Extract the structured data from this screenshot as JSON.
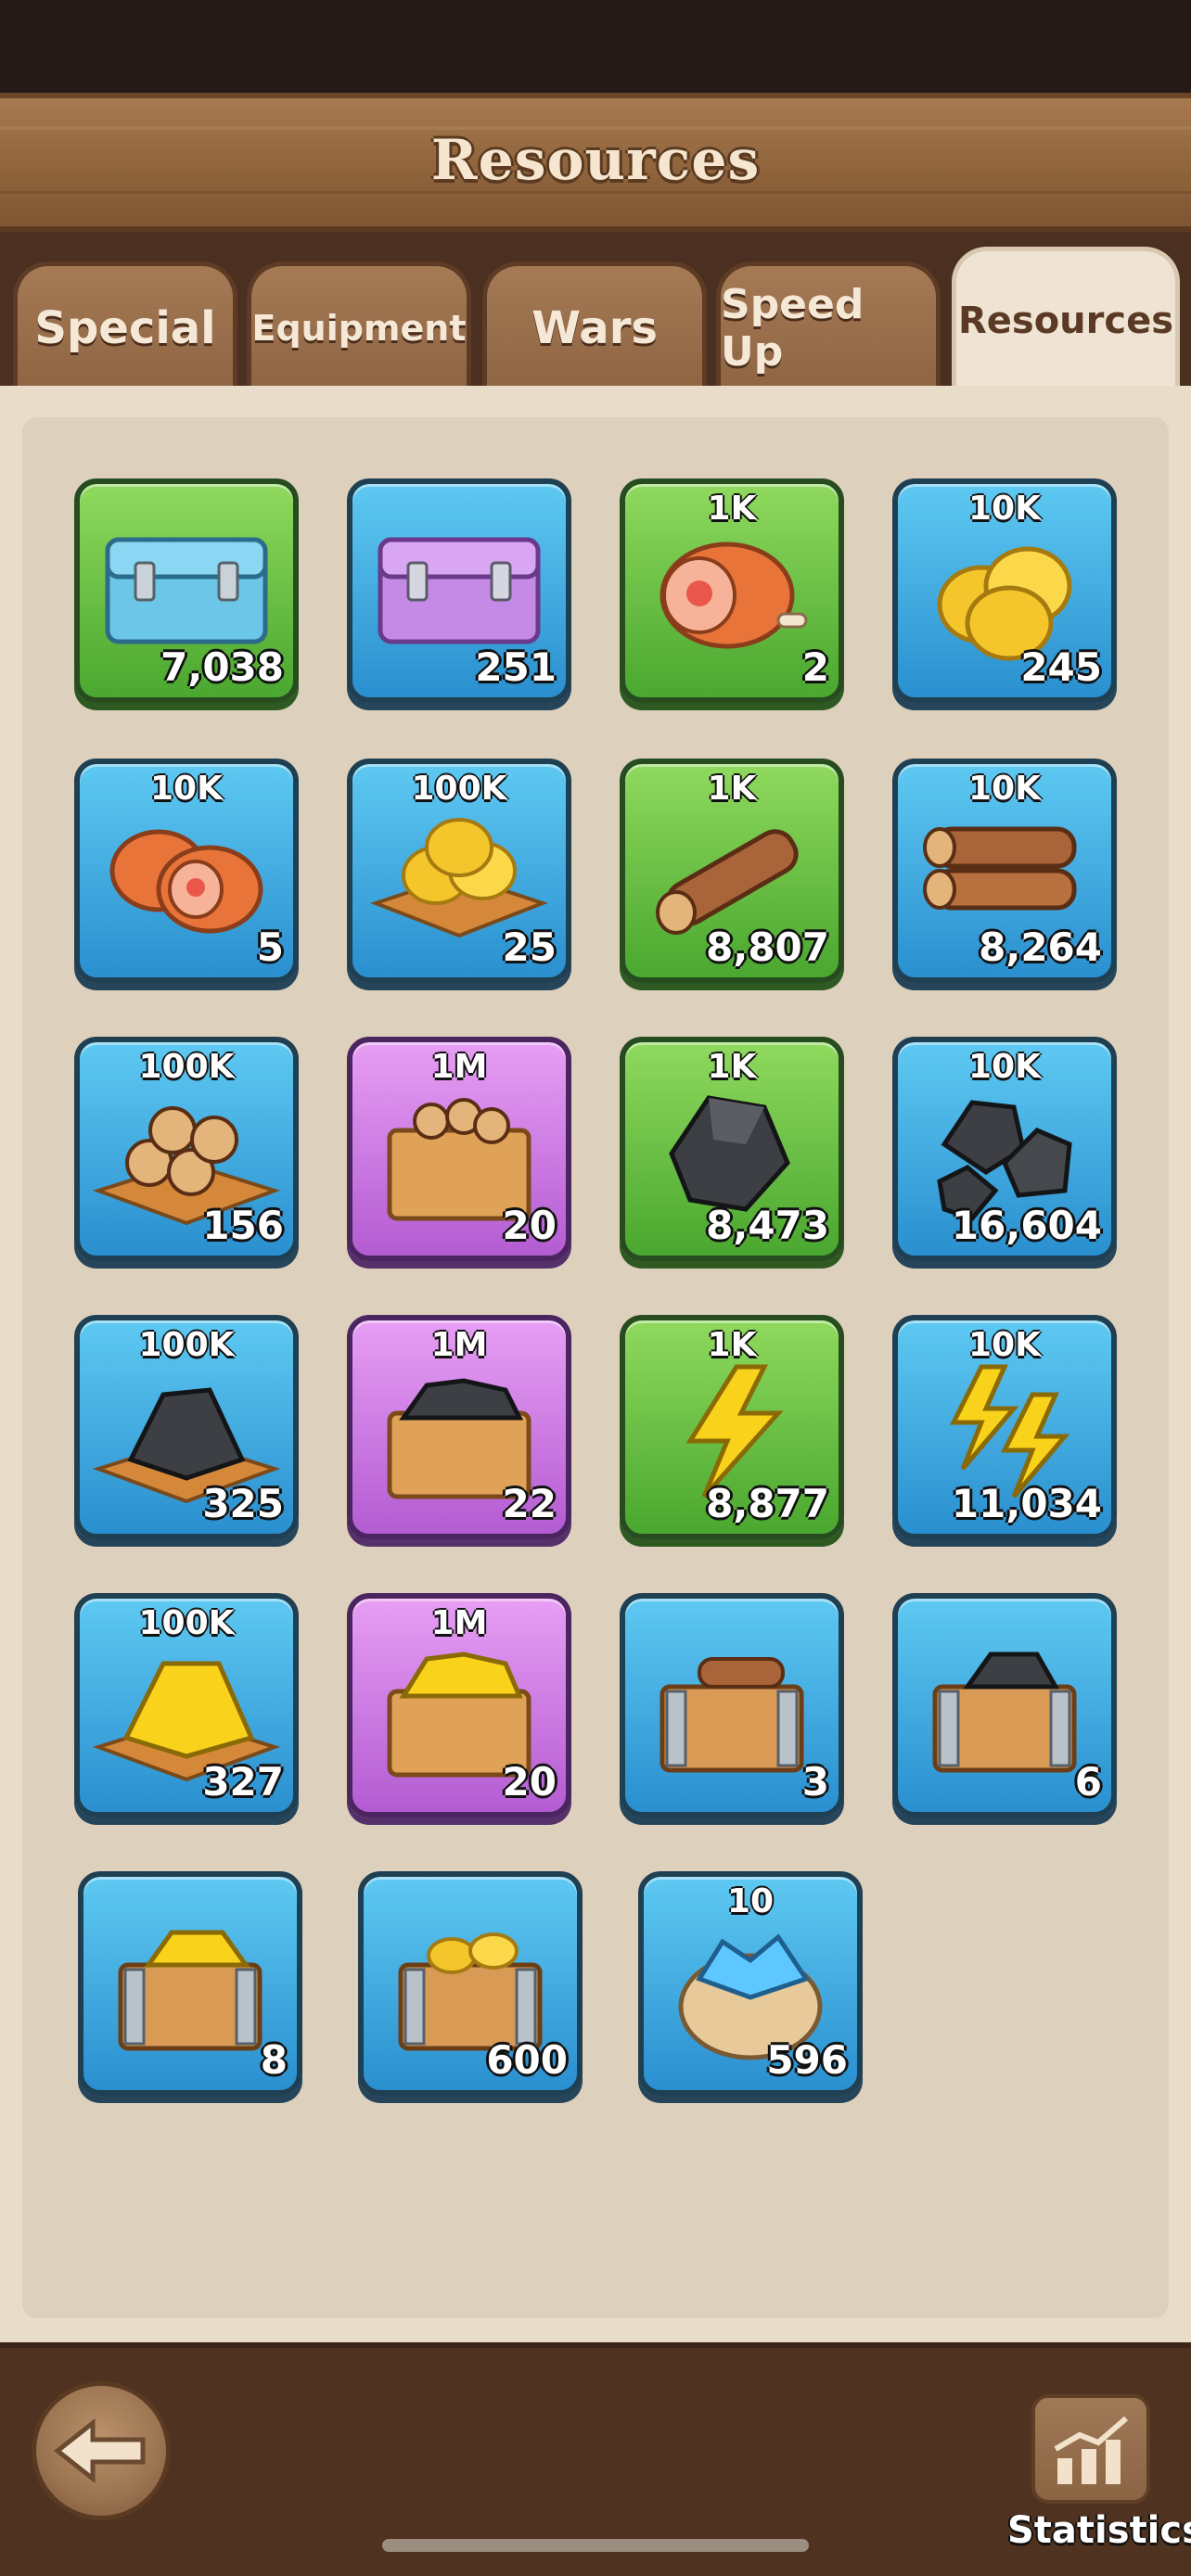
{
  "header": {
    "title": "Resources"
  },
  "tabs": [
    {
      "label": "Special"
    },
    {
      "label": "Equipment"
    },
    {
      "label": "Wars"
    },
    {
      "label": "Speed Up"
    },
    {
      "label": "Resources",
      "active": true
    }
  ],
  "items": [
    {
      "icon": "blue-chest-icon",
      "amount": "",
      "count": "7,038",
      "tile": "green"
    },
    {
      "icon": "purple-chest-icon",
      "amount": "",
      "count": "251",
      "tile": "blue"
    },
    {
      "icon": "meat-icon",
      "amount": "1K",
      "count": "2",
      "tile": "green"
    },
    {
      "icon": "gold-coins-icon",
      "amount": "10K",
      "count": "245",
      "tile": "blue"
    },
    {
      "icon": "meat-pile-icon",
      "amount": "10K",
      "count": "5",
      "tile": "blue"
    },
    {
      "icon": "gold-coins-pallet-icon",
      "amount": "100K",
      "count": "25",
      "tile": "blue"
    },
    {
      "icon": "wood-log-icon",
      "amount": "1K",
      "count": "8,807",
      "tile": "green"
    },
    {
      "icon": "wood-logs-icon",
      "amount": "10K",
      "count": "8,264",
      "tile": "blue"
    },
    {
      "icon": "wood-pallet-icon",
      "amount": "100K",
      "count": "156",
      "tile": "blue"
    },
    {
      "icon": "wood-crate-icon",
      "amount": "1M",
      "count": "20",
      "tile": "purple"
    },
    {
      "icon": "stone-icon",
      "amount": "1K",
      "count": "8,473",
      "tile": "green"
    },
    {
      "icon": "stones-icon",
      "amount": "10K",
      "count": "16,604",
      "tile": "blue"
    },
    {
      "icon": "stone-pallet-icon",
      "amount": "100K",
      "count": "325",
      "tile": "blue"
    },
    {
      "icon": "stone-crate-icon",
      "amount": "1M",
      "count": "22",
      "tile": "purple"
    },
    {
      "icon": "energy-bolt-icon",
      "amount": "1K",
      "count": "8,877",
      "tile": "green"
    },
    {
      "icon": "energy-bolts-icon",
      "amount": "10K",
      "count": "11,034",
      "tile": "blue"
    },
    {
      "icon": "energy-pallet-icon",
      "amount": "100K",
      "count": "327",
      "tile": "blue"
    },
    {
      "icon": "energy-crate-icon",
      "amount": "1M",
      "count": "20",
      "tile": "purple"
    },
    {
      "icon": "wood-chest-icon",
      "amount": "",
      "count": "3",
      "tile": "blue"
    },
    {
      "icon": "stone-chest-icon",
      "amount": "",
      "count": "6",
      "tile": "blue"
    },
    {
      "icon": "energy-chest-icon",
      "amount": "",
      "count": "8",
      "tile": "blue"
    },
    {
      "icon": "gold-chest-icon",
      "amount": "",
      "count": "600",
      "tile": "blue"
    },
    {
      "icon": "gem-bag-icon",
      "amount": "10",
      "count": "596",
      "tile": "blue"
    }
  ],
  "footer": {
    "stats_label": "Statistics"
  },
  "colors": {
    "tile_blue": "#2a8fcf",
    "tile_green": "#4aa72f",
    "tile_purple": "#b35cd2",
    "header_wood": "#94683f"
  }
}
